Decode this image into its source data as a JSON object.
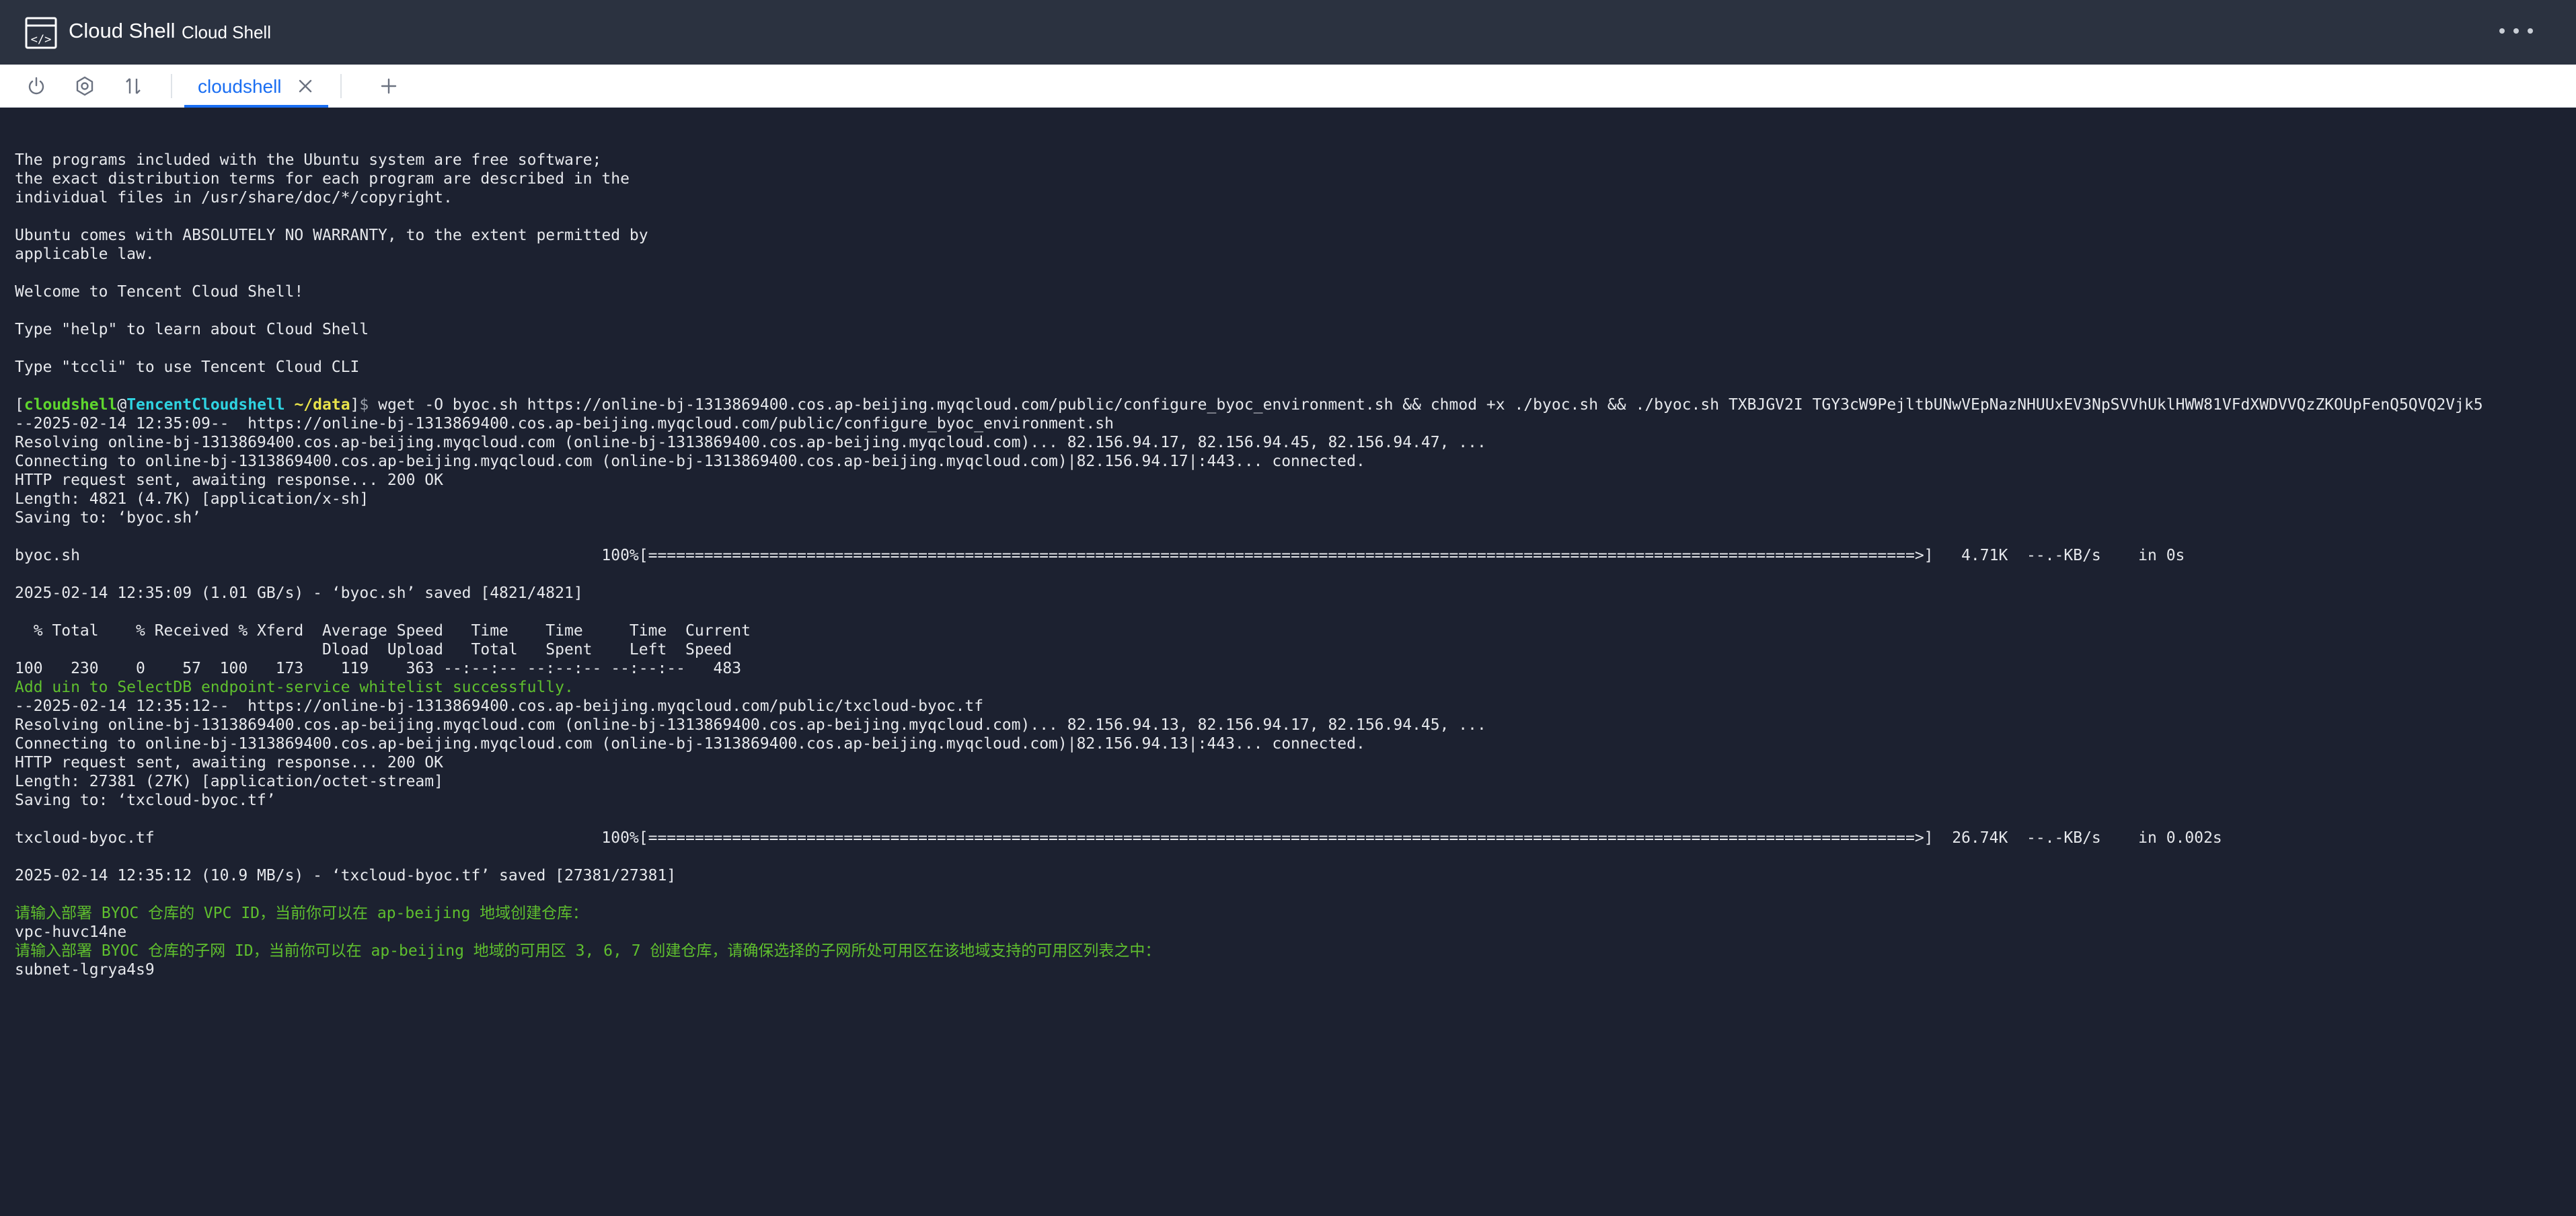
{
  "window": {
    "title": "Cloud Shell",
    "subtitle": "Cloud Shell",
    "logo_icon": "cloud-shell-logo-icon",
    "more_icon": "more-horizontal-icon"
  },
  "toolbar": {
    "power_icon": "power-icon",
    "settings_icon": "settings-icon",
    "transfer_icon": "upload-download-icon"
  },
  "tabs": [
    {
      "label": "cloudshell",
      "active": true,
      "close_icon": "close-icon"
    }
  ],
  "add_tab_icon": "plus-icon",
  "colors": {
    "titlebar_bg": "#2b3240",
    "terminal_bg": "#1c2130",
    "accent": "#1a6ef2",
    "info_green": "#5fbf2e",
    "prompt_user": "#5fd62e",
    "prompt_host": "#2fd4e2",
    "prompt_path": "#e8e34a"
  },
  "terminal": {
    "intro": [
      "The programs included with the Ubuntu system are free software;",
      "the exact distribution terms for each program are described in the",
      "individual files in /usr/share/doc/*/copyright.",
      "",
      "Ubuntu comes with ABSOLUTELY NO WARRANTY, to the extent permitted by",
      "applicable law.",
      "",
      "Welcome to Tencent Cloud Shell!",
      "",
      "Type \"help\" to learn about Cloud Shell",
      "",
      "Type \"tccli\" to use Tencent Cloud CLI",
      ""
    ],
    "prompt": {
      "open": "[",
      "user": "cloudshell",
      "at": "@",
      "host": "TencentCloudshell",
      "path": " ~/data",
      "close": "]",
      "symbol": "$ ",
      "command": "wget -O byoc.sh https://online-bj-1313869400.cos.ap-beijing.myqcloud.com/public/configure_byoc_environment.sh && chmod +x ./byoc.sh && ./byoc.sh TXBJGV2I TGY3cW9PejltbUNwVEpNazNHUUxEV3NpSVVhUklHWW81VFdXWDVVQzZKOUpFenQ5QVQ2Vjk5"
    },
    "download1": [
      "--2025-02-14 12:35:09--  https://online-bj-1313869400.cos.ap-beijing.myqcloud.com/public/configure_byoc_environment.sh",
      "Resolving online-bj-1313869400.cos.ap-beijing.myqcloud.com (online-bj-1313869400.cos.ap-beijing.myqcloud.com)... 82.156.94.17, 82.156.94.45, 82.156.94.47, ...",
      "Connecting to online-bj-1313869400.cos.ap-beijing.myqcloud.com (online-bj-1313869400.cos.ap-beijing.myqcloud.com)|82.156.94.17|:443... connected.",
      "HTTP request sent, awaiting response... 200 OK",
      "Length: 4821 (4.7K) [application/x-sh]",
      "Saving to: ‘byoc.sh’",
      "",
      "byoc.sh                                                        100%[========================================================================================================================================>]   4.71K  --.-KB/s    in 0s",
      "",
      "2025-02-14 12:35:09 (1.01 GB/s) - ‘byoc.sh’ saved [4821/4821]",
      "",
      "  % Total    % Received % Xferd  Average Speed   Time    Time     Time  Current",
      "                                 Dload  Upload   Total   Spent    Left  Speed",
      "100   230    0    57  100   173    119    363 --:--:-- --:--:-- --:--:--   483"
    ],
    "whitelist_msg": "Add uin to SelectDB endpoint-service whitelist successfully.",
    "download2": [
      "--2025-02-14 12:35:12--  https://online-bj-1313869400.cos.ap-beijing.myqcloud.com/public/txcloud-byoc.tf",
      "Resolving online-bj-1313869400.cos.ap-beijing.myqcloud.com (online-bj-1313869400.cos.ap-beijing.myqcloud.com)... 82.156.94.13, 82.156.94.17, 82.156.94.45, ...",
      "Connecting to online-bj-1313869400.cos.ap-beijing.myqcloud.com (online-bj-1313869400.cos.ap-beijing.myqcloud.com)|82.156.94.13|:443... connected.",
      "HTTP request sent, awaiting response... 200 OK",
      "Length: 27381 (27K) [application/octet-stream]",
      "Saving to: ‘txcloud-byoc.tf’",
      "",
      "txcloud-byoc.tf                                                100%[========================================================================================================================================>]  26.74K  --.-KB/s    in 0.002s",
      "",
      "2025-02-14 12:35:12 (10.9 MB/s) - ‘txcloud-byoc.tf’ saved [27381/27381]",
      ""
    ],
    "vpc_prompt": "请输入部署 BYOC 仓库的 VPC ID，当前你可以在 ap-beijing 地域创建仓库：",
    "vpc_value": "vpc-huvc14ne",
    "subnet_prompt": "请输入部署 BYOC 仓库的子网 ID，当前你可以在 ap-beijing 地域的可用区 3, 6, 7 创建仓库，请确保选择的子网所处可用区在该地域支持的可用区列表之中：",
    "subnet_value": "subnet-lgrya4s9"
  }
}
